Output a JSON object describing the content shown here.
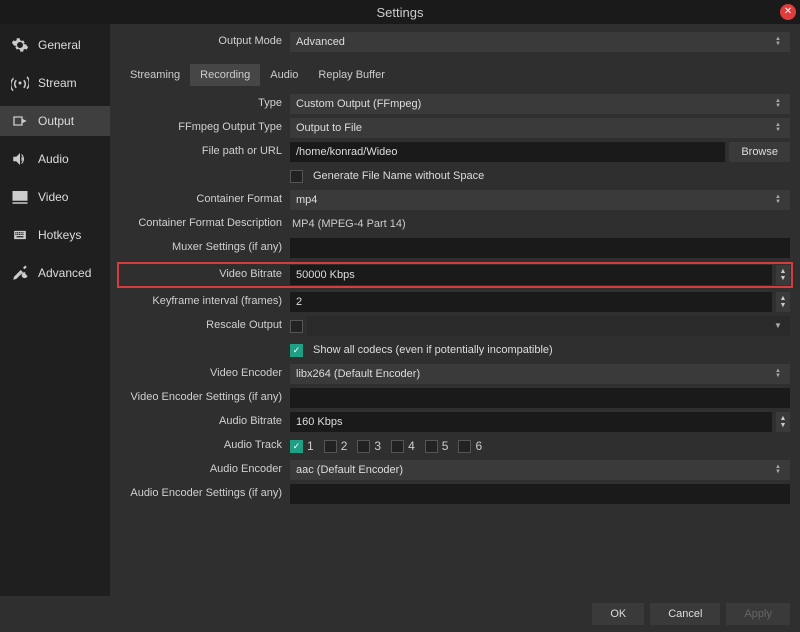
{
  "window": {
    "title": "Settings"
  },
  "sidebar": {
    "items": [
      {
        "label": "General"
      },
      {
        "label": "Stream"
      },
      {
        "label": "Output"
      },
      {
        "label": "Audio"
      },
      {
        "label": "Video"
      },
      {
        "label": "Hotkeys"
      },
      {
        "label": "Advanced"
      }
    ]
  },
  "outputMode": {
    "label": "Output Mode",
    "value": "Advanced"
  },
  "tabs": [
    {
      "label": "Streaming"
    },
    {
      "label": "Recording"
    },
    {
      "label": "Audio"
    },
    {
      "label": "Replay Buffer"
    }
  ],
  "fields": {
    "type": {
      "label": "Type",
      "value": "Custom Output (FFmpeg)"
    },
    "ffmpegOutputType": {
      "label": "FFmpeg Output Type",
      "value": "Output to File"
    },
    "filePath": {
      "label": "File path or URL",
      "value": "/home/konrad/Wideo",
      "browse": "Browse"
    },
    "generateFileName": {
      "label": "Generate File Name without Space",
      "checked": false
    },
    "containerFormat": {
      "label": "Container Format",
      "value": "mp4"
    },
    "containerFormatDesc": {
      "label": "Container Format Description",
      "value": "MP4 (MPEG-4 Part 14)"
    },
    "muxerSettings": {
      "label": "Muxer Settings (if any)",
      "value": ""
    },
    "videoBitrate": {
      "label": "Video Bitrate",
      "value": "50000 Kbps"
    },
    "keyframeInterval": {
      "label": "Keyframe interval (frames)",
      "value": "2"
    },
    "rescaleOutput": {
      "label": "Rescale Output",
      "checked": false,
      "value": ""
    },
    "showAllCodecs": {
      "label": "Show all codecs (even if potentially incompatible)",
      "checked": true
    },
    "videoEncoder": {
      "label": "Video Encoder",
      "value": "libx264 (Default Encoder)"
    },
    "videoEncoderSettings": {
      "label": "Video Encoder Settings (if any)",
      "value": ""
    },
    "audioBitrate": {
      "label": "Audio Bitrate",
      "value": "160 Kbps"
    },
    "audioTrack": {
      "label": "Audio Track",
      "tracks": [
        "1",
        "2",
        "3",
        "4",
        "5",
        "6"
      ],
      "checked": [
        true,
        false,
        false,
        false,
        false,
        false
      ]
    },
    "audioEncoder": {
      "label": "Audio Encoder",
      "value": "aac (Default Encoder)"
    },
    "audioEncoderSettings": {
      "label": "Audio Encoder Settings (if any)",
      "value": ""
    }
  },
  "footer": {
    "ok": "OK",
    "cancel": "Cancel",
    "apply": "Apply"
  }
}
